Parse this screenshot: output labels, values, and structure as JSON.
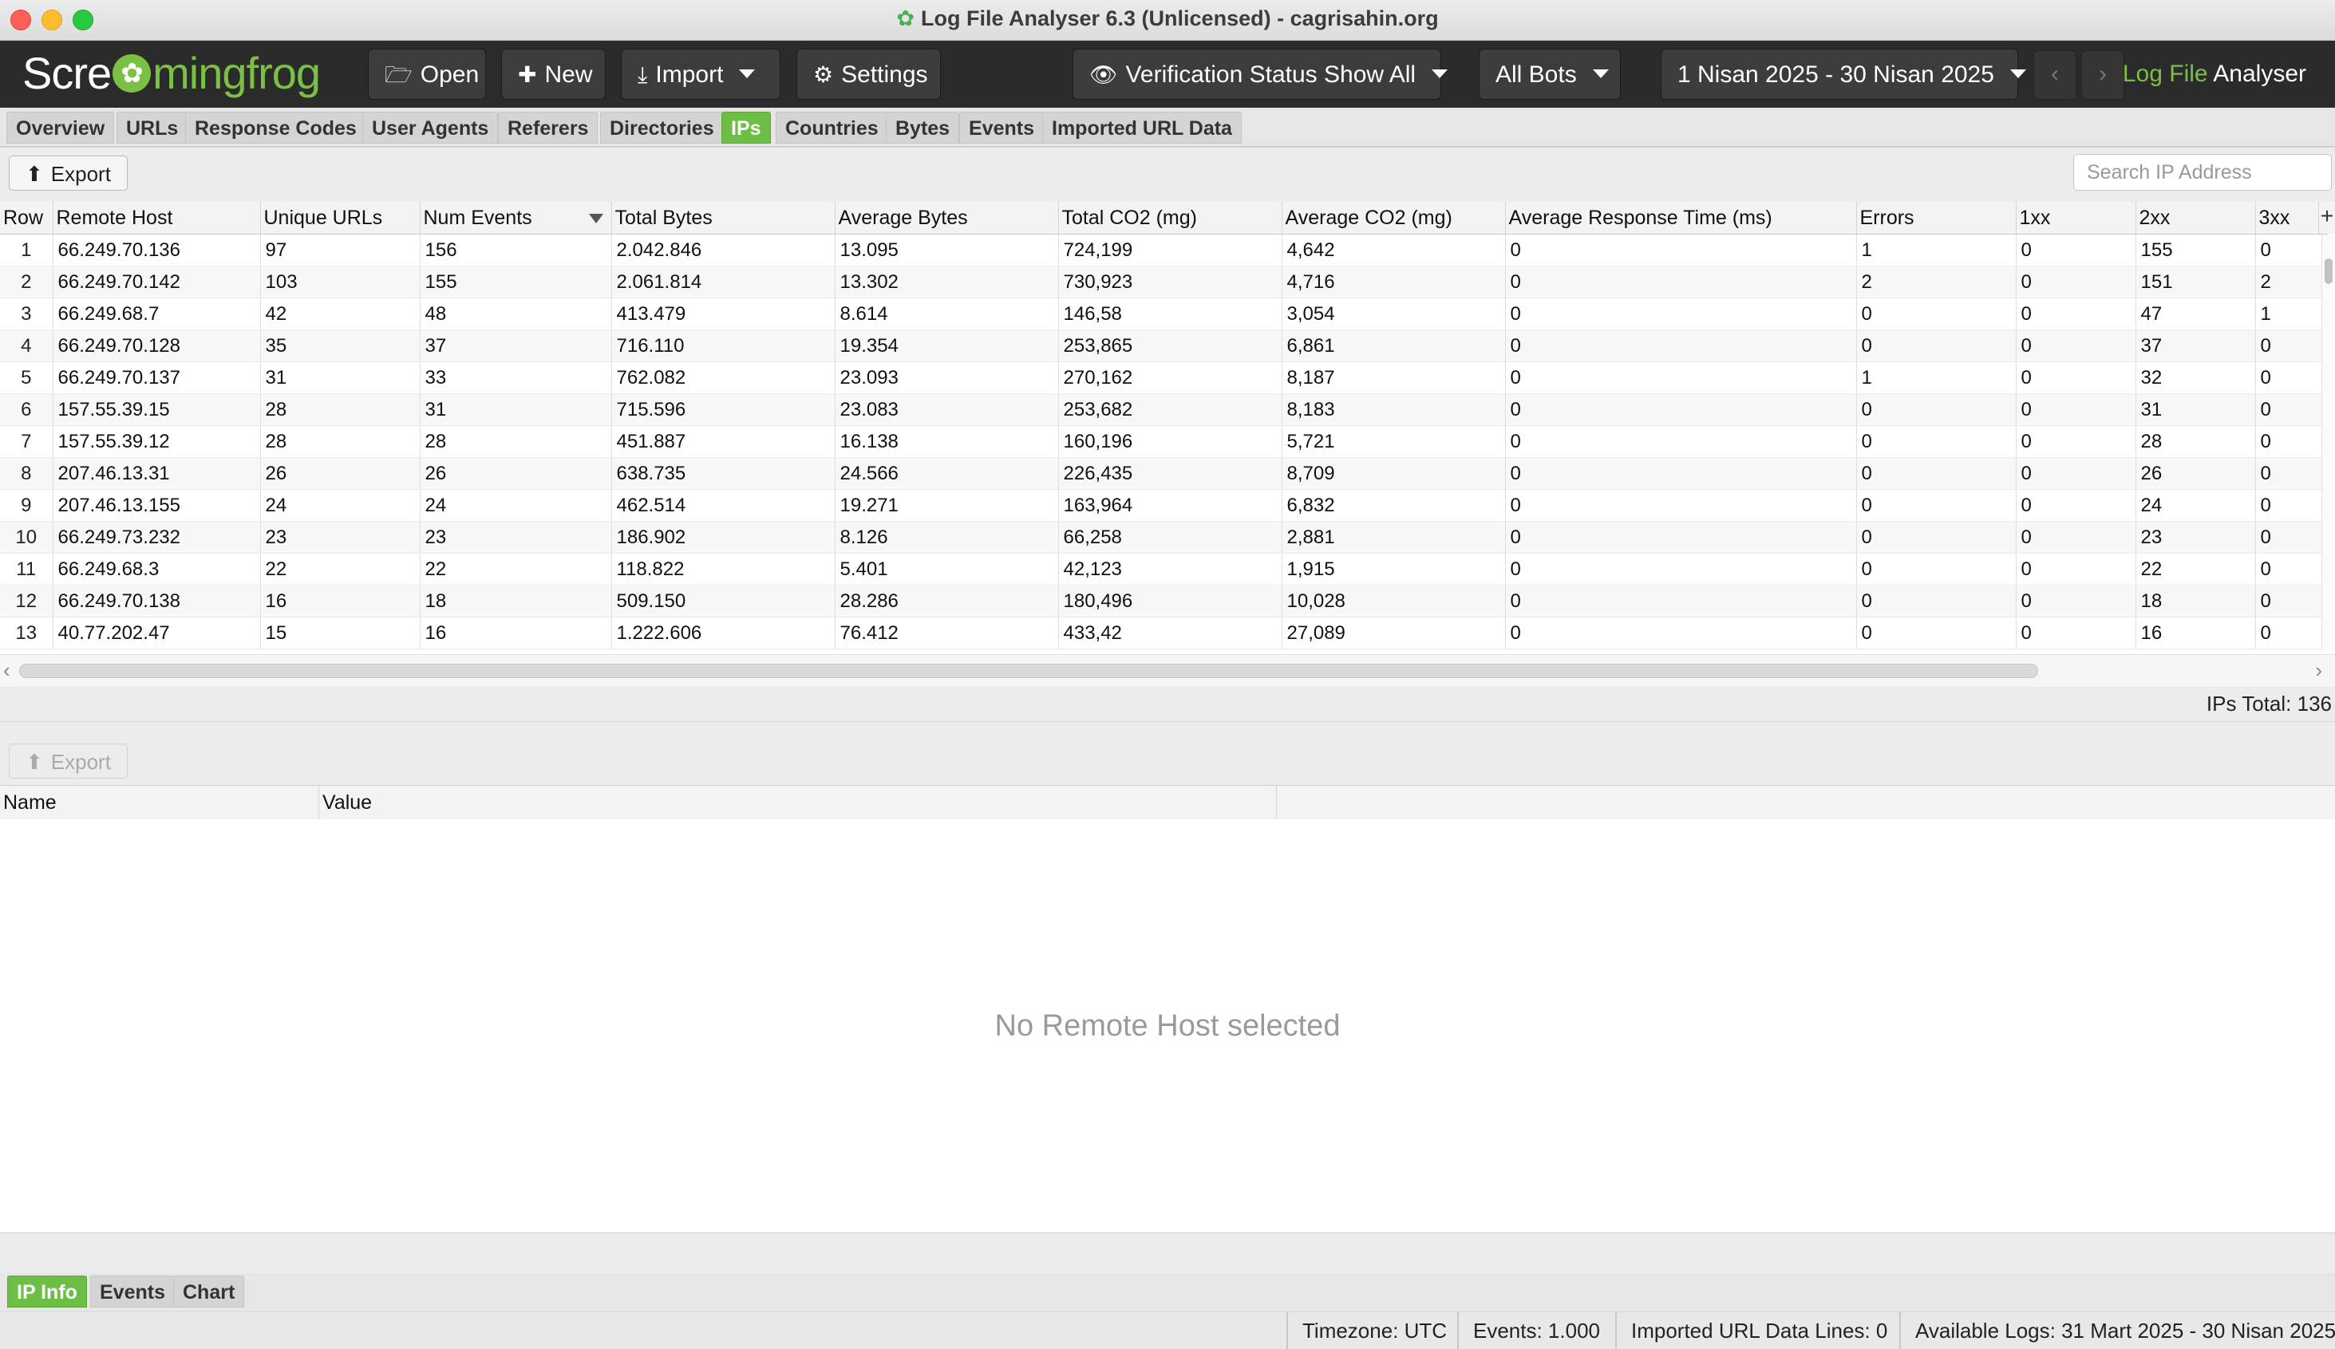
{
  "window": {
    "title": "Log File Analyser 6.3 (Unlicensed) - cagrisahin.org"
  },
  "toolbar": {
    "logo_pre": "Scre",
    "logo_post": "mingfrog",
    "open": "Open",
    "new": "New",
    "import": "Import",
    "settings": "Settings",
    "verification": "Verification Status Show All",
    "bots": "All Bots",
    "date_range": "1 Nisan 2025 - 30 Nisan 2025",
    "prev": "‹",
    "next": "›",
    "product_green": "Log File",
    "product_white": " Analyser"
  },
  "tabs": [
    "Overview",
    "URLs",
    "Response Codes",
    "User Agents",
    "Referers",
    "Directories",
    "IPs",
    "Countries",
    "Bytes",
    "Events",
    "Imported URL Data"
  ],
  "active_tab": "IPs",
  "upper": {
    "export": "Export",
    "search_placeholder": "Search IP Address",
    "total": "IPs Total: 136"
  },
  "table": {
    "columns": [
      "Row",
      "Remote Host",
      "Unique URLs",
      "Num Events",
      "Total Bytes",
      "Average Bytes",
      "Total CO2 (mg)",
      "Average CO2 (mg)",
      "Average Response Time (ms)",
      "Errors",
      "1xx",
      "2xx",
      "3xx"
    ],
    "sorted_column": "Num Events",
    "rows": [
      [
        "1",
        "66.249.70.136",
        "97",
        "156",
        "2.042.846",
        "13.095",
        "724,199",
        "4,642",
        "0",
        "1",
        "0",
        "155",
        "0"
      ],
      [
        "2",
        "66.249.70.142",
        "103",
        "155",
        "2.061.814",
        "13.302",
        "730,923",
        "4,716",
        "0",
        "2",
        "0",
        "151",
        "2"
      ],
      [
        "3",
        "66.249.68.7",
        "42",
        "48",
        "413.479",
        "8.614",
        "146,58",
        "3,054",
        "0",
        "0",
        "0",
        "47",
        "1"
      ],
      [
        "4",
        "66.249.70.128",
        "35",
        "37",
        "716.110",
        "19.354",
        "253,865",
        "6,861",
        "0",
        "0",
        "0",
        "37",
        "0"
      ],
      [
        "5",
        "66.249.70.137",
        "31",
        "33",
        "762.082",
        "23.093",
        "270,162",
        "8,187",
        "0",
        "1",
        "0",
        "32",
        "0"
      ],
      [
        "6",
        "157.55.39.15",
        "28",
        "31",
        "715.596",
        "23.083",
        "253,682",
        "8,183",
        "0",
        "0",
        "0",
        "31",
        "0"
      ],
      [
        "7",
        "157.55.39.12",
        "28",
        "28",
        "451.887",
        "16.138",
        "160,196",
        "5,721",
        "0",
        "0",
        "0",
        "28",
        "0"
      ],
      [
        "8",
        "207.46.13.31",
        "26",
        "26",
        "638.735",
        "24.566",
        "226,435",
        "8,709",
        "0",
        "0",
        "0",
        "26",
        "0"
      ],
      [
        "9",
        "207.46.13.155",
        "24",
        "24",
        "462.514",
        "19.271",
        "163,964",
        "6,832",
        "0",
        "0",
        "0",
        "24",
        "0"
      ],
      [
        "10",
        "66.249.73.232",
        "23",
        "23",
        "186.902",
        "8.126",
        "66,258",
        "2,881",
        "0",
        "0",
        "0",
        "23",
        "0"
      ],
      [
        "11",
        "66.249.68.3",
        "22",
        "22",
        "118.822",
        "5.401",
        "42,123",
        "1,915",
        "0",
        "0",
        "0",
        "22",
        "0"
      ],
      [
        "12",
        "66.249.70.138",
        "16",
        "18",
        "509.150",
        "28.286",
        "180,496",
        "10,028",
        "0",
        "0",
        "0",
        "18",
        "0"
      ],
      [
        "13",
        "40.77.202.47",
        "15",
        "16",
        "1.222.606",
        "76.412",
        "433,42",
        "27,089",
        "0",
        "0",
        "0",
        "16",
        "0"
      ]
    ]
  },
  "lower": {
    "export": "Export",
    "col_name": "Name",
    "col_value": "Value",
    "empty": "No Remote Host selected"
  },
  "bottom_tabs": [
    "IP Info",
    "Events",
    "Chart"
  ],
  "active_bottom_tab": "IP Info",
  "status": {
    "timezone": "Timezone:  UTC",
    "events": "Events:  1.000",
    "imported": "Imported URL Data Lines:  0",
    "available": "Available Logs:  31 Mart 2025 - 30 Nisan 2025"
  },
  "colors": {
    "accent_green": "#6cbe45",
    "toolbar_bg": "#2b2b2b"
  },
  "icons": [
    "frog-icon",
    "folder-open-icon",
    "plus-icon",
    "download-icon",
    "gear-icon",
    "eye-icon",
    "upload-icon"
  ]
}
